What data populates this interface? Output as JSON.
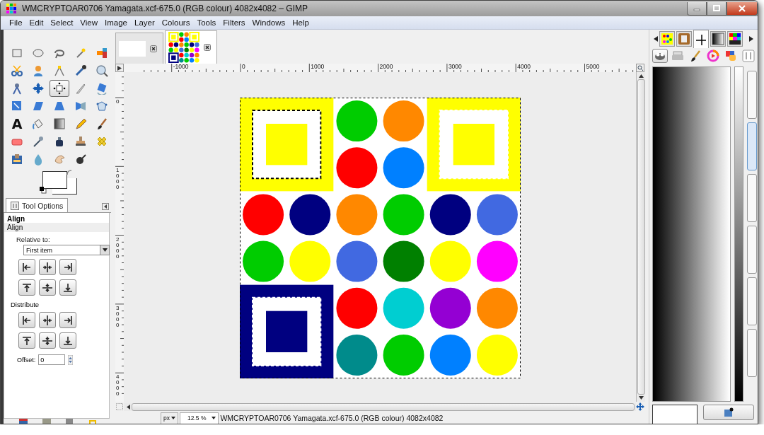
{
  "window": {
    "title": "WMCRYPTOAR0706 Yamagata.xcf-675.0 (RGB colour) 4082x4082 – GIMP"
  },
  "menu": [
    "File",
    "Edit",
    "Select",
    "View",
    "Image",
    "Layer",
    "Colours",
    "Tools",
    "Filters",
    "Windows",
    "Help"
  ],
  "toolbox": {
    "tools": [
      {
        "selected": false
      },
      {
        "selected": false
      },
      {
        "selected": false
      },
      {
        "selected": false
      },
      {
        "selected": false
      },
      {
        "selected": false
      },
      {
        "selected": false
      },
      {
        "selected": false
      },
      {
        "selected": false
      },
      {
        "selected": false
      },
      {
        "selected": false
      },
      {
        "selected": false
      },
      {
        "selected": true
      },
      {
        "selected": false
      },
      {
        "selected": false
      },
      {
        "selected": false
      },
      {
        "selected": false
      },
      {
        "selected": false
      },
      {
        "selected": false
      },
      {
        "selected": false
      },
      {
        "selected": false,
        "glyph": "A"
      },
      {
        "selected": false
      },
      {
        "selected": false
      },
      {
        "selected": false
      },
      {
        "selected": false
      },
      {
        "selected": false
      },
      {
        "selected": false
      },
      {
        "selected": false
      },
      {
        "selected": false
      },
      {
        "selected": false
      },
      {
        "selected": false
      },
      {
        "selected": false
      },
      {
        "selected": false
      },
      {
        "selected": false
      }
    ]
  },
  "tool_options": {
    "tab": "Tool Options",
    "heading": "Align",
    "section": "Align",
    "relative_label": "Relative to:",
    "relative_value": "First item",
    "distribute_label": "Distribute",
    "offset_label": "Offset:",
    "offset_value": "0"
  },
  "image_tabs": [
    {
      "selected": false
    },
    {
      "selected": true
    }
  ],
  "rulers": {
    "horizontal": [
      "-1000",
      "0",
      "1000",
      "2000",
      "3000",
      "4000",
      "5000"
    ],
    "vertical": [
      "0",
      "1000",
      "2000",
      "3000",
      "4000"
    ]
  },
  "image": {
    "frames": [
      {
        "color": "#ffff00",
        "selected": true
      },
      {
        "color": "#ffff00",
        "selected": false
      },
      {
        "color": "#000080",
        "selected": false
      }
    ],
    "circles": [
      {
        "color": "#00cc00"
      },
      {
        "color": "#ff8800"
      },
      {
        "color": "#ff0000"
      },
      {
        "color": "#0080ff"
      },
      {
        "color": "#ff0000"
      },
      {
        "color": "#000080"
      },
      {
        "color": "#ff8800"
      },
      {
        "color": "#00cc00"
      },
      {
        "color": "#000080"
      },
      {
        "color": "#4169e1"
      },
      {
        "color": "#00cc00"
      },
      {
        "color": "#ffff00"
      },
      {
        "color": "#4169e1"
      },
      {
        "color": "#008000"
      },
      {
        "color": "#ffff00"
      },
      {
        "color": "#ff00ff"
      },
      {
        "color": "#ff0000"
      },
      {
        "color": "#00ced1"
      },
      {
        "color": "#9400d3"
      },
      {
        "color": "#ff8800"
      },
      {
        "color": "#008b8b"
      },
      {
        "color": "#00cc00"
      },
      {
        "color": "#0080ff"
      },
      {
        "color": "#ffff00"
      }
    ]
  },
  "status_bar": {
    "unit": "px",
    "zoom": "12.5 %",
    "text": "WMCRYPTOAR0706 Yamagata.xcf-675.0 (RGB colour) 4082x4082"
  },
  "dock": {
    "tabs": [
      {
        "selected": false
      },
      {
        "selected": false
      },
      {
        "selected": true
      },
      {
        "selected": false
      },
      {
        "selected": false
      }
    ],
    "panel_tabs": [
      {
        "selected": true
      },
      {
        "selected": false
      },
      {
        "selected": false
      },
      {
        "selected": false
      },
      {
        "selected": false
      },
      {
        "selected": false
      }
    ],
    "side_buttons": [
      {
        "selected": false
      },
      {
        "selected": true
      },
      {
        "selected": false
      },
      {
        "selected": false
      },
      {
        "selected": false
      },
      {
        "selected": false
      }
    ]
  }
}
